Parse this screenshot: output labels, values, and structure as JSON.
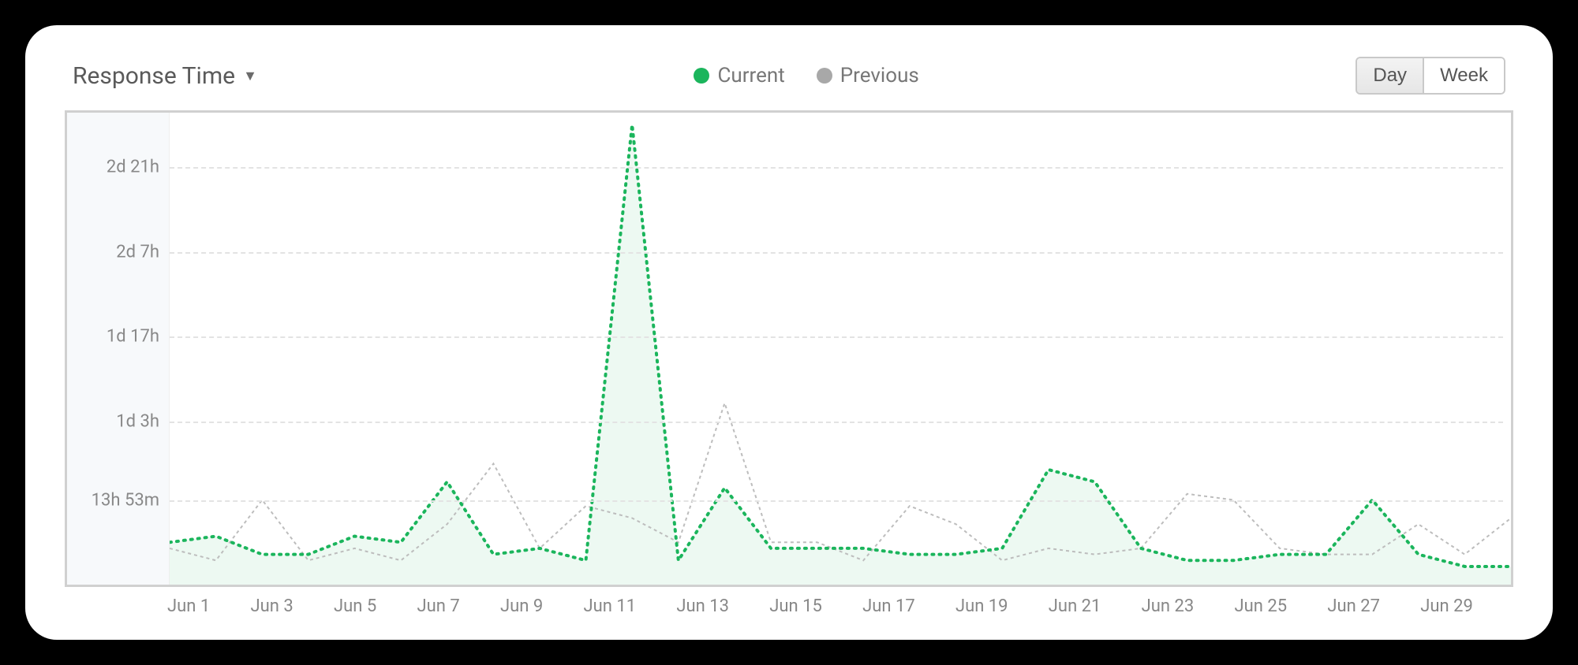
{
  "title": "Response Time",
  "legend": {
    "current": {
      "label": "Current",
      "color": "#1bb55c"
    },
    "previous": {
      "label": "Previous",
      "color": "#a8a8a8"
    }
  },
  "toggle": {
    "day": "Day",
    "week": "Week",
    "active": "day"
  },
  "chart_data": {
    "type": "line",
    "title": "Response Time",
    "xlabel": "",
    "ylabel": "",
    "y_ticks": [
      "13h 53m",
      "1d 3h",
      "1d 17h",
      "2d 7h",
      "2d 21h"
    ],
    "y_tick_hours": [
      13.9,
      27,
      41,
      55,
      69
    ],
    "ylim_hours": [
      0,
      78
    ],
    "categories": [
      "Jun 1",
      "Jun 2",
      "Jun 3",
      "Jun 4",
      "Jun 5",
      "Jun 6",
      "Jun 7",
      "Jun 8",
      "Jun 9",
      "Jun 10",
      "Jun 11",
      "Jun 12",
      "Jun 13",
      "Jun 14",
      "Jun 15",
      "Jun 16",
      "Jun 17",
      "Jun 18",
      "Jun 19",
      "Jun 20",
      "Jun 21",
      "Jun 22",
      "Jun 23",
      "Jun 24",
      "Jun 25",
      "Jun 26",
      "Jun 27",
      "Jun 28",
      "Jun 29",
      "Jun 30"
    ],
    "x_tick_show": [
      "Jun 1",
      "Jun 3",
      "Jun 5",
      "Jun 7",
      "Jun 9",
      "Jun 11",
      "Jun 13",
      "Jun 15",
      "Jun 17",
      "Jun 19",
      "Jun 21",
      "Jun 23",
      "Jun 25",
      "Jun 27",
      "Jun 29"
    ],
    "series": [
      {
        "name": "Current",
        "color": "#1bb55c",
        "fill": "rgba(27,181,92,0.08)",
        "values_hours": [
          7,
          8,
          5,
          5,
          8,
          7,
          17,
          5,
          6,
          4,
          76,
          4,
          16,
          6,
          6,
          6,
          5,
          5,
          6,
          19,
          17,
          6,
          4,
          4,
          5,
          5,
          14,
          5,
          3,
          3
        ]
      },
      {
        "name": "Previous",
        "color": "#bdbdbd",
        "fill": "none",
        "values_hours": [
          6,
          4,
          14,
          4,
          6,
          4,
          10,
          20,
          6,
          13,
          11,
          7,
          30,
          7,
          7,
          4,
          13,
          10,
          4,
          6,
          5,
          6,
          15,
          14,
          6,
          5,
          5,
          10,
          5,
          11
        ]
      }
    ]
  }
}
